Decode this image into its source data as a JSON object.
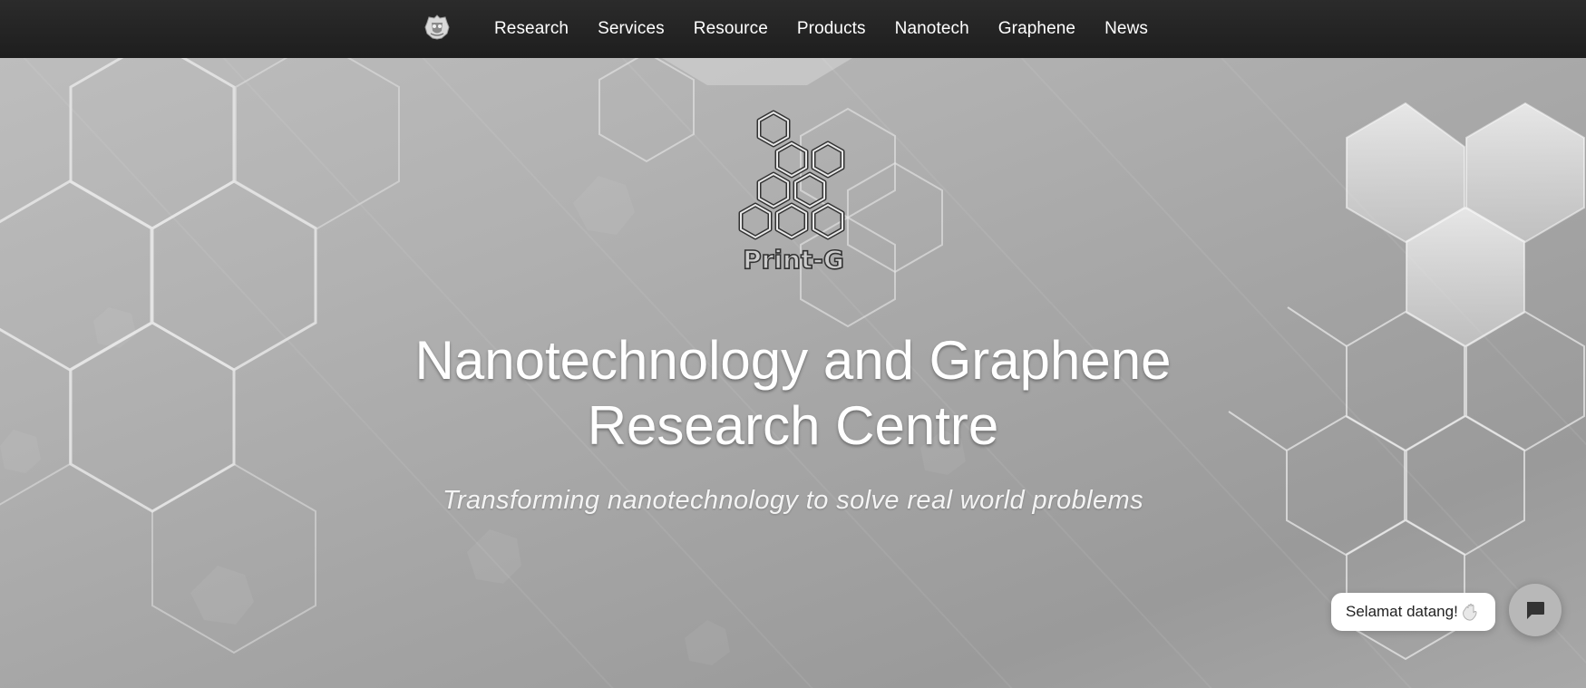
{
  "nav": {
    "logo_icon": "university-crest-icon",
    "links": [
      "Research",
      "Services",
      "Resource",
      "Products",
      "Nanotech",
      "Graphene",
      "News"
    ]
  },
  "hero": {
    "logo_text": "Print-G",
    "logo_icon": "honeycomb-hexagon-icon",
    "title_line1": "Nanotechnology and Graphene",
    "title_line2": "Research Centre",
    "subtitle": "Transforming nanotechnology to solve real world problems"
  },
  "chat": {
    "greeting": "Selamat datang!",
    "greeting_icon": "waving-hand-icon",
    "button_icon": "chat-icon"
  },
  "colors": {
    "nav_background": "#222222",
    "hero_background": "#ababab",
    "text": "#ffffff"
  }
}
